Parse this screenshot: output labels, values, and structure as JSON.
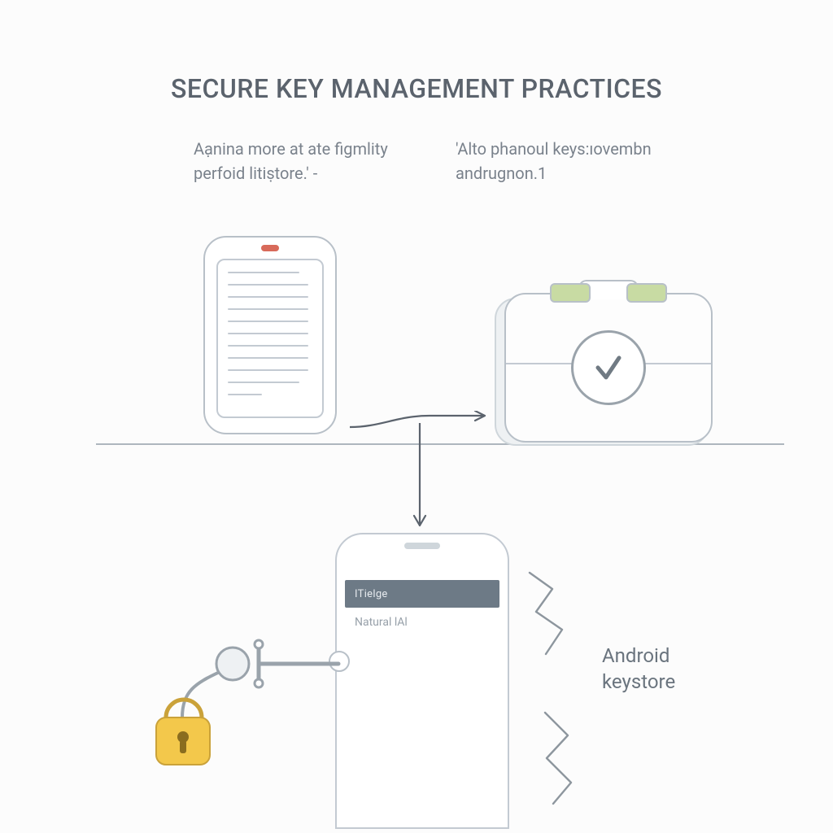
{
  "title_parts": {
    "a": "S",
    "b": "ECURE ",
    "c": "K",
    "d": "EY ",
    "e": "M",
    "f": "ANAGEMENT ",
    "g": "P",
    "h": "RACTICES"
  },
  "caption_left_l1": "Aạnina more at ate figmlity",
  "caption_left_l2": "perfoid litiṣtore.' -",
  "caption_right_l1": "'Alto phanoul keys:ıovembn",
  "caption_right_l2": "andrugnon.1",
  "phone_bar_label": "ITielge",
  "phone_sub_label": "Natural lAl",
  "right_label_l1": "Android",
  "right_label_l2": "keystore",
  "icons": {
    "checkmark": "check-icon",
    "padlock": "padlock-icon",
    "briefcase": "briefcase-icon",
    "document-phone": "document-phone-icon",
    "arrow-right": "arrow-right-icon",
    "arrow-down": "arrow-down-icon"
  },
  "colors": {
    "stroke": "#b8c0c8",
    "stroke_soft": "#c3cad2",
    "text": "#606a74",
    "accent_green": "#c8dba3",
    "accent_red": "#d86a5a",
    "lock_yellow": "#f3c84b",
    "bar_grey": "#6d7a86"
  }
}
